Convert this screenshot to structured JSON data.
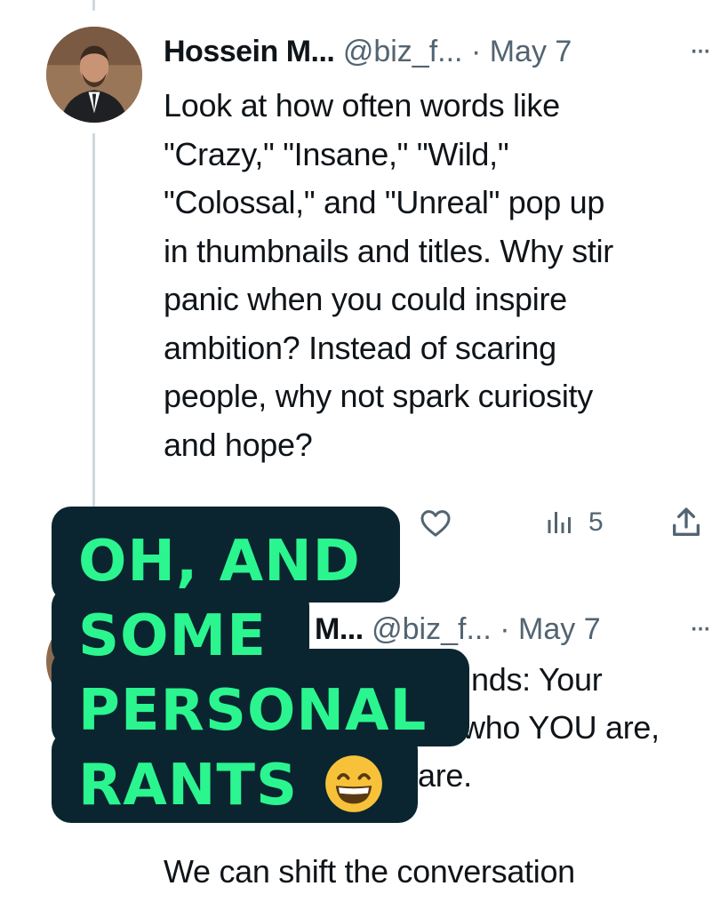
{
  "tweet1": {
    "author_name": "Hossein M...",
    "handle": "@biz_f...",
    "separator": "·",
    "date": "May 7",
    "more_label": "···",
    "body_lines": [
      "Look at how often words like",
      "\"Crazy,\" \"Insane,\" \"Wild,\"",
      "\"Colossal,\" and \"Unreal\" pop up",
      "in thumbnails and titles. Why stir",
      "panic when you could inspire",
      "ambition? Instead of scaring",
      "people, why not spark curiosity",
      "and hope?"
    ],
    "actions": {
      "views_count": "5"
    }
  },
  "tweet2": {
    "author_name_visible": "M...",
    "handle": "@biz_f...",
    "separator": "·",
    "date": "May 7",
    "more_label": "···",
    "body_fragments": [
      "nds: Your",
      "who YOU are,",
      "are."
    ],
    "body_line_last": "We can shift the conversation"
  },
  "overlay": {
    "lines": [
      "OH, AND",
      "SOME",
      "PERSONAL",
      "RANTS"
    ],
    "emoji": "grinning-face-with-smiling-eyes",
    "colors": {
      "background": "#0a2530",
      "text": "#2bf58f"
    }
  },
  "colors": {
    "text_primary": "#0f1419",
    "text_secondary": "#536471",
    "thread_line": "#cfd9de"
  }
}
